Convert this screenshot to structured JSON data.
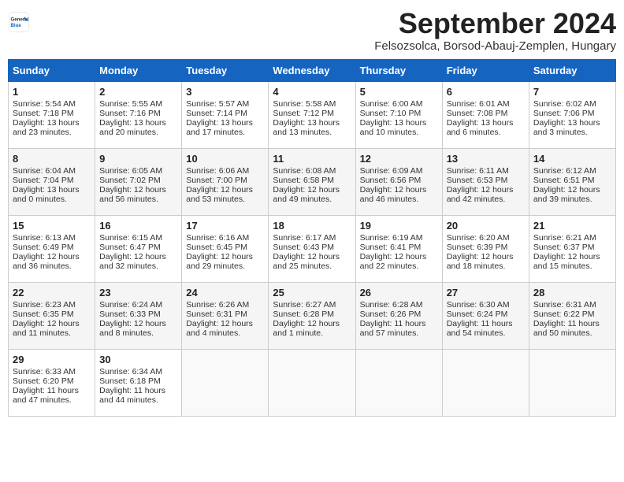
{
  "header": {
    "logo_general": "General",
    "logo_blue": "Blue",
    "month_title": "September 2024",
    "subtitle": "Felsozsolca, Borsod-Abauj-Zemplen, Hungary"
  },
  "days_of_week": [
    "Sunday",
    "Monday",
    "Tuesday",
    "Wednesday",
    "Thursday",
    "Friday",
    "Saturday"
  ],
  "weeks": [
    [
      {
        "day": "1",
        "lines": [
          "Sunrise: 5:54 AM",
          "Sunset: 7:18 PM",
          "Daylight: 13 hours",
          "and 23 minutes."
        ]
      },
      {
        "day": "2",
        "lines": [
          "Sunrise: 5:55 AM",
          "Sunset: 7:16 PM",
          "Daylight: 13 hours",
          "and 20 minutes."
        ]
      },
      {
        "day": "3",
        "lines": [
          "Sunrise: 5:57 AM",
          "Sunset: 7:14 PM",
          "Daylight: 13 hours",
          "and 17 minutes."
        ]
      },
      {
        "day": "4",
        "lines": [
          "Sunrise: 5:58 AM",
          "Sunset: 7:12 PM",
          "Daylight: 13 hours",
          "and 13 minutes."
        ]
      },
      {
        "day": "5",
        "lines": [
          "Sunrise: 6:00 AM",
          "Sunset: 7:10 PM",
          "Daylight: 13 hours",
          "and 10 minutes."
        ]
      },
      {
        "day": "6",
        "lines": [
          "Sunrise: 6:01 AM",
          "Sunset: 7:08 PM",
          "Daylight: 13 hours",
          "and 6 minutes."
        ]
      },
      {
        "day": "7",
        "lines": [
          "Sunrise: 6:02 AM",
          "Sunset: 7:06 PM",
          "Daylight: 13 hours",
          "and 3 minutes."
        ]
      }
    ],
    [
      {
        "day": "8",
        "lines": [
          "Sunrise: 6:04 AM",
          "Sunset: 7:04 PM",
          "Daylight: 13 hours",
          "and 0 minutes."
        ]
      },
      {
        "day": "9",
        "lines": [
          "Sunrise: 6:05 AM",
          "Sunset: 7:02 PM",
          "Daylight: 12 hours",
          "and 56 minutes."
        ]
      },
      {
        "day": "10",
        "lines": [
          "Sunrise: 6:06 AM",
          "Sunset: 7:00 PM",
          "Daylight: 12 hours",
          "and 53 minutes."
        ]
      },
      {
        "day": "11",
        "lines": [
          "Sunrise: 6:08 AM",
          "Sunset: 6:58 PM",
          "Daylight: 12 hours",
          "and 49 minutes."
        ]
      },
      {
        "day": "12",
        "lines": [
          "Sunrise: 6:09 AM",
          "Sunset: 6:56 PM",
          "Daylight: 12 hours",
          "and 46 minutes."
        ]
      },
      {
        "day": "13",
        "lines": [
          "Sunrise: 6:11 AM",
          "Sunset: 6:53 PM",
          "Daylight: 12 hours",
          "and 42 minutes."
        ]
      },
      {
        "day": "14",
        "lines": [
          "Sunrise: 6:12 AM",
          "Sunset: 6:51 PM",
          "Daylight: 12 hours",
          "and 39 minutes."
        ]
      }
    ],
    [
      {
        "day": "15",
        "lines": [
          "Sunrise: 6:13 AM",
          "Sunset: 6:49 PM",
          "Daylight: 12 hours",
          "and 36 minutes."
        ]
      },
      {
        "day": "16",
        "lines": [
          "Sunrise: 6:15 AM",
          "Sunset: 6:47 PM",
          "Daylight: 12 hours",
          "and 32 minutes."
        ]
      },
      {
        "day": "17",
        "lines": [
          "Sunrise: 6:16 AM",
          "Sunset: 6:45 PM",
          "Daylight: 12 hours",
          "and 29 minutes."
        ]
      },
      {
        "day": "18",
        "lines": [
          "Sunrise: 6:17 AM",
          "Sunset: 6:43 PM",
          "Daylight: 12 hours",
          "and 25 minutes."
        ]
      },
      {
        "day": "19",
        "lines": [
          "Sunrise: 6:19 AM",
          "Sunset: 6:41 PM",
          "Daylight: 12 hours",
          "and 22 minutes."
        ]
      },
      {
        "day": "20",
        "lines": [
          "Sunrise: 6:20 AM",
          "Sunset: 6:39 PM",
          "Daylight: 12 hours",
          "and 18 minutes."
        ]
      },
      {
        "day": "21",
        "lines": [
          "Sunrise: 6:21 AM",
          "Sunset: 6:37 PM",
          "Daylight: 12 hours",
          "and 15 minutes."
        ]
      }
    ],
    [
      {
        "day": "22",
        "lines": [
          "Sunrise: 6:23 AM",
          "Sunset: 6:35 PM",
          "Daylight: 12 hours",
          "and 11 minutes."
        ]
      },
      {
        "day": "23",
        "lines": [
          "Sunrise: 6:24 AM",
          "Sunset: 6:33 PM",
          "Daylight: 12 hours",
          "and 8 minutes."
        ]
      },
      {
        "day": "24",
        "lines": [
          "Sunrise: 6:26 AM",
          "Sunset: 6:31 PM",
          "Daylight: 12 hours",
          "and 4 minutes."
        ]
      },
      {
        "day": "25",
        "lines": [
          "Sunrise: 6:27 AM",
          "Sunset: 6:28 PM",
          "Daylight: 12 hours",
          "and 1 minute."
        ]
      },
      {
        "day": "26",
        "lines": [
          "Sunrise: 6:28 AM",
          "Sunset: 6:26 PM",
          "Daylight: 11 hours",
          "and 57 minutes."
        ]
      },
      {
        "day": "27",
        "lines": [
          "Sunrise: 6:30 AM",
          "Sunset: 6:24 PM",
          "Daylight: 11 hours",
          "and 54 minutes."
        ]
      },
      {
        "day": "28",
        "lines": [
          "Sunrise: 6:31 AM",
          "Sunset: 6:22 PM",
          "Daylight: 11 hours",
          "and 50 minutes."
        ]
      }
    ],
    [
      {
        "day": "29",
        "lines": [
          "Sunrise: 6:33 AM",
          "Sunset: 6:20 PM",
          "Daylight: 11 hours",
          "and 47 minutes."
        ]
      },
      {
        "day": "30",
        "lines": [
          "Sunrise: 6:34 AM",
          "Sunset: 6:18 PM",
          "Daylight: 11 hours",
          "and 44 minutes."
        ]
      },
      {
        "day": "",
        "lines": []
      },
      {
        "day": "",
        "lines": []
      },
      {
        "day": "",
        "lines": []
      },
      {
        "day": "",
        "lines": []
      },
      {
        "day": "",
        "lines": []
      }
    ]
  ]
}
